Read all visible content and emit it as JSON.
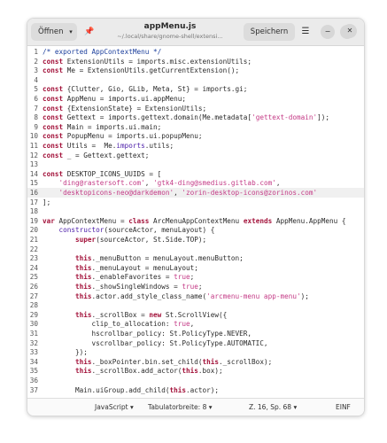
{
  "header": {
    "open_label": "Öffnen",
    "open_caret": "▾",
    "pin_icon": "📌",
    "title": "appMenu.js",
    "subtitle": "~/.local/share/gnome-shell/extensi…",
    "save_label": "Speichern",
    "menu_icon": "☰",
    "minimize": "−",
    "maximize": "⤢",
    "close": "✕"
  },
  "editor": {
    "lines": [
      {
        "n": "1",
        "segs": [
          [
            "/* exported AppContextMenu */",
            "cm"
          ]
        ]
      },
      {
        "n": "2",
        "segs": [
          [
            "const",
            "kw"
          ],
          [
            " ExtensionUtils = imports.misc.extensionUtils;",
            ""
          ]
        ]
      },
      {
        "n": "3",
        "segs": [
          [
            "const",
            "kw"
          ],
          [
            " Me = ExtensionUtils.getCurrentExtension();",
            ""
          ]
        ]
      },
      {
        "n": "4",
        "segs": []
      },
      {
        "n": "5",
        "segs": [
          [
            "const",
            "kw"
          ],
          [
            " {Clutter, Gio, GLib, Meta, St} = imports.gi;",
            ""
          ]
        ]
      },
      {
        "n": "6",
        "segs": [
          [
            "const",
            "kw"
          ],
          [
            " AppMenu = imports.ui.appMenu;",
            ""
          ]
        ]
      },
      {
        "n": "7",
        "segs": [
          [
            "const",
            "kw"
          ],
          [
            " {ExtensionState} = ExtensionUtils;",
            ""
          ]
        ]
      },
      {
        "n": "8",
        "segs": [
          [
            "const",
            "kw"
          ],
          [
            " Gettext = imports.gettext.domain(Me.metadata[",
            ""
          ],
          [
            "'gettext-domain'",
            "str"
          ],
          [
            "]);",
            ""
          ]
        ]
      },
      {
        "n": "9",
        "segs": [
          [
            "const",
            "kw"
          ],
          [
            " Main = imports.ui.main;",
            ""
          ]
        ]
      },
      {
        "n": "10",
        "segs": [
          [
            "const",
            "kw"
          ],
          [
            " PopupMenu = imports.ui.popupMenu;",
            ""
          ]
        ]
      },
      {
        "n": "11",
        "segs": [
          [
            "const",
            "kw"
          ],
          [
            " Utils =  Me.",
            ""
          ],
          [
            "imports",
            "fn"
          ],
          [
            ".utils;",
            ""
          ]
        ]
      },
      {
        "n": "12",
        "segs": [
          [
            "const",
            "kw"
          ],
          [
            " _ = Gettext.gettext;",
            ""
          ]
        ]
      },
      {
        "n": "13",
        "segs": []
      },
      {
        "n": "14",
        "segs": [
          [
            "const",
            "kw"
          ],
          [
            " DESKTOP_ICONS_UUIDS = [",
            ""
          ]
        ]
      },
      {
        "n": "15",
        "segs": [
          [
            "    ",
            ""
          ],
          [
            "'ding@rastersoft.com'",
            "str"
          ],
          [
            ", ",
            ""
          ],
          [
            "'gtk4-ding@smedius.gitlab.com'",
            "str"
          ],
          [
            ",",
            ""
          ]
        ]
      },
      {
        "n": "16",
        "segs": [
          [
            "    ",
            ""
          ],
          [
            "'desktopicons-neo@darkdemon'",
            "str"
          ],
          [
            ", ",
            ""
          ],
          [
            "'zorin-desktop-icons@zorinos.com'",
            "str"
          ]
        ]
      },
      {
        "n": "17",
        "segs": [
          [
            "];",
            ""
          ]
        ]
      },
      {
        "n": "18",
        "segs": []
      },
      {
        "n": "19",
        "segs": [
          [
            "var",
            "kw"
          ],
          [
            " AppContextMenu = ",
            ""
          ],
          [
            "class",
            "kw"
          ],
          [
            " ArcMenuAppContextMenu ",
            ""
          ],
          [
            "extends",
            "kw"
          ],
          [
            " AppMenu.AppMenu {",
            ""
          ]
        ]
      },
      {
        "n": "20",
        "segs": [
          [
            "    ",
            ""
          ],
          [
            "constructor",
            "fn"
          ],
          [
            "(sourceActor, menuLayout) {",
            ""
          ]
        ]
      },
      {
        "n": "21",
        "segs": [
          [
            "        ",
            ""
          ],
          [
            "super",
            "kw"
          ],
          [
            "(sourceActor, St.Side.TOP);",
            ""
          ]
        ]
      },
      {
        "n": "22",
        "segs": []
      },
      {
        "n": "23",
        "segs": [
          [
            "        ",
            ""
          ],
          [
            "this",
            "kw"
          ],
          [
            "._menuButton = menuLayout.menuButton;",
            ""
          ]
        ]
      },
      {
        "n": "24",
        "segs": [
          [
            "        ",
            ""
          ],
          [
            "this",
            "kw"
          ],
          [
            "._menuLayout = menuLayout;",
            ""
          ]
        ]
      },
      {
        "n": "25",
        "segs": [
          [
            "        ",
            ""
          ],
          [
            "this",
            "kw"
          ],
          [
            "._enableFavorites = ",
            ""
          ],
          [
            "true",
            "str"
          ],
          [
            ";",
            ""
          ]
        ]
      },
      {
        "n": "26",
        "segs": [
          [
            "        ",
            ""
          ],
          [
            "this",
            "kw"
          ],
          [
            "._showSingleWindows = ",
            ""
          ],
          [
            "true",
            "str"
          ],
          [
            ";",
            ""
          ]
        ]
      },
      {
        "n": "27",
        "segs": [
          [
            "        ",
            ""
          ],
          [
            "this",
            "kw"
          ],
          [
            ".actor.add_style_class_name(",
            ""
          ],
          [
            "'arcmenu-menu app-menu'",
            "str"
          ],
          [
            ");",
            ""
          ]
        ]
      },
      {
        "n": "28",
        "segs": []
      },
      {
        "n": "29",
        "segs": [
          [
            "        ",
            ""
          ],
          [
            "this",
            "kw"
          ],
          [
            "._scrollBox = ",
            ""
          ],
          [
            "new",
            "kw"
          ],
          [
            " St.ScrollView({",
            ""
          ]
        ]
      },
      {
        "n": "30",
        "segs": [
          [
            "            clip_to_allocation: ",
            ""
          ],
          [
            "true",
            "str"
          ],
          [
            ",",
            ""
          ]
        ]
      },
      {
        "n": "31",
        "segs": [
          [
            "            hscrollbar_policy: St.PolicyType.NEVER,",
            ""
          ]
        ]
      },
      {
        "n": "32",
        "segs": [
          [
            "            vscrollbar_policy: St.PolicyType.AUTOMATIC,",
            ""
          ]
        ]
      },
      {
        "n": "33",
        "segs": [
          [
            "        });",
            ""
          ]
        ]
      },
      {
        "n": "34",
        "segs": [
          [
            "        ",
            ""
          ],
          [
            "this",
            "kw"
          ],
          [
            "._boxPointer.bin.set_child(",
            ""
          ],
          [
            "this",
            "kw"
          ],
          [
            "._scrollBox);",
            ""
          ]
        ]
      },
      {
        "n": "35",
        "segs": [
          [
            "        ",
            ""
          ],
          [
            "this",
            "kw"
          ],
          [
            "._scrollBox.add_actor(",
            ""
          ],
          [
            "this",
            "kw"
          ],
          [
            ".box);",
            ""
          ]
        ]
      },
      {
        "n": "36",
        "segs": []
      },
      {
        "n": "37",
        "segs": [
          [
            "        Main.uiGroup.add_child(",
            ""
          ],
          [
            "this",
            "kw"
          ],
          [
            ".actor);",
            ""
          ]
        ]
      }
    ]
  },
  "status": {
    "language": "JavaScript",
    "language_caret": "▾",
    "tab_width": "Tabulatorbreite: 8",
    "tab_caret": "▾",
    "position": "Z. 16, Sp. 68",
    "position_caret": "▾",
    "mode": "EINF"
  },
  "colors": {
    "keyword": "#a3133b",
    "comment": "#1c3f9c",
    "string": "#c43a86",
    "function": "#4a1ca8"
  }
}
